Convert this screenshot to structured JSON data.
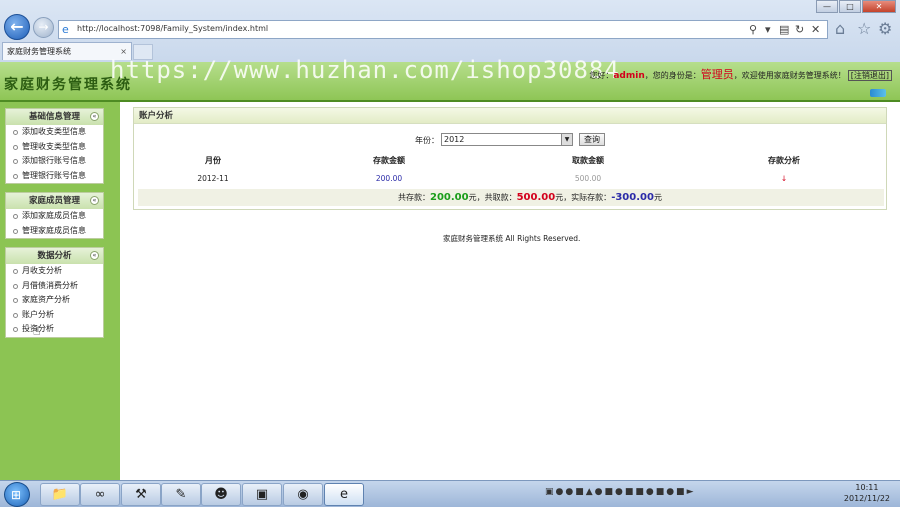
{
  "browser": {
    "url": "http://localhost:7098/Family_System/index.html",
    "tab_title": "家庭财务管理系统",
    "window_buttons": [
      "—",
      "□",
      "✕"
    ]
  },
  "header": {
    "app_title": "家庭财务管理系统",
    "watermark": "https://www.huzhan.com/ishop30884",
    "welcome_prefix": "您好：",
    "username": "admin",
    "role_prefix": "，您的身份是：",
    "role": "管理员",
    "welcome_suffix": "，欢迎使用家庭财务管理系统！",
    "logout": "[注销退出]"
  },
  "sidebar": {
    "groups": [
      {
        "title": "基础信息管理",
        "items": [
          "添加收支类型信息",
          "管理收支类型信息",
          "添加银行账号信息",
          "管理银行账号信息"
        ]
      },
      {
        "title": "家庭成员管理",
        "items": [
          "添加家庭成员信息",
          "管理家庭成员信息"
        ]
      },
      {
        "title": "数据分析",
        "items": [
          "月收支分析",
          "月借债消费分析",
          "家庭资产分析",
          "账户分析",
          "投资分析"
        ]
      }
    ]
  },
  "main": {
    "panel_title": "账户分析",
    "year_label": "年份：",
    "year_value": "2012",
    "query_button": "查询",
    "columns": [
      "月份",
      "存款金额",
      "取款金额",
      "存款分析"
    ],
    "row": {
      "month": "2012-11",
      "deposit": "200.00",
      "withdraw": "500.00",
      "trend": "↓"
    },
    "summary": {
      "deposit_label": "共存款：",
      "deposit_value": "200.00",
      "unit": "元",
      "withdraw_label": "，共取款：",
      "withdraw_value": "500.00",
      "actual_label": "，实际存款：",
      "actual_value": "-300.00"
    },
    "footer": "家庭财务管理系统 All Rights Reserved."
  },
  "taskbar": {
    "clock_time": "10:11",
    "clock_date": "2012/11/22"
  },
  "colors": {
    "banner_green": "#8cc453",
    "sidebar_green": "#8cc453",
    "accent_red": "#d3001c",
    "deposit_green": "#1a9d1a",
    "actual_blue": "#2b2ba8"
  }
}
